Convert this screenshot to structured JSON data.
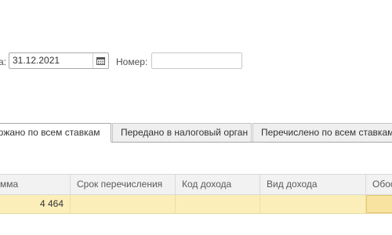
{
  "header": {
    "date_label": "а:",
    "date_value": "31.12.2021",
    "number_label": "Номер:",
    "number_value": ""
  },
  "tabs": [
    {
      "label": "ержано по всем ставкам",
      "active": true
    },
    {
      "label": "Передано в налоговый орган",
      "active": false
    },
    {
      "label": "Перечислено по всем ставкам",
      "active": false
    }
  ],
  "table": {
    "columns": [
      "мма",
      "Срок перечисления",
      "Код дохода",
      "Вид дохода",
      "Обос"
    ],
    "rows": [
      [
        "4 464",
        "",
        "",
        "",
        ""
      ]
    ]
  },
  "icons": {
    "calendar": "calendar-icon"
  },
  "colors": {
    "selected_row": "#fbeeb8",
    "tab_inactive": "#efefef",
    "header_bg": "#f2f2f2"
  }
}
